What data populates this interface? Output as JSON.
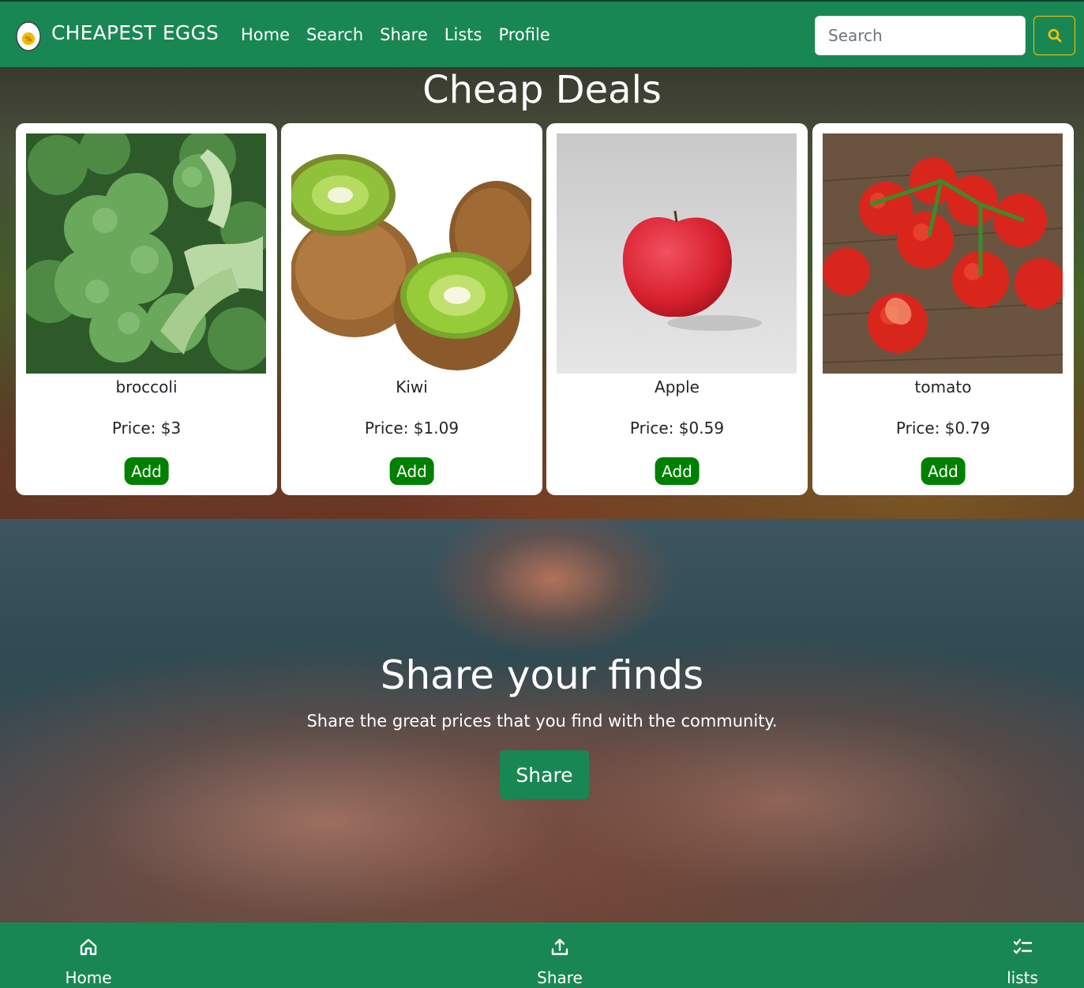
{
  "navbar": {
    "brand": "CHEAPEST EGGS",
    "links": [
      "Home",
      "Search",
      "Share",
      "Lists",
      "Profile"
    ],
    "search_placeholder": "Search"
  },
  "deals": {
    "title": "Cheap Deals",
    "items": [
      {
        "name": "broccoli",
        "price": "Price: $3",
        "button": "Add",
        "image": "broccoli-photo"
      },
      {
        "name": "Kiwi",
        "price": "Price: $1.09",
        "button": "Add",
        "image": "kiwi-photo"
      },
      {
        "name": "Apple",
        "price": "Price: $0.59",
        "button": "Add",
        "image": "apple-photo"
      },
      {
        "name": "tomato",
        "price": "Price: $0.79",
        "button": "Add",
        "image": "tomato-photo"
      }
    ]
  },
  "share": {
    "title": "Share your finds",
    "subtitle": "Share the great prices that you find with the community.",
    "button": "Share"
  },
  "bottom_nav": {
    "items": [
      {
        "label": "Home",
        "icon": "home-icon"
      },
      {
        "label": "Share",
        "icon": "upload-icon"
      },
      {
        "label": "lists",
        "icon": "checklist-icon"
      }
    ]
  },
  "colors": {
    "primary_green": "#198754",
    "add_button_green": "#008000",
    "search_accent": "#ffc107"
  }
}
